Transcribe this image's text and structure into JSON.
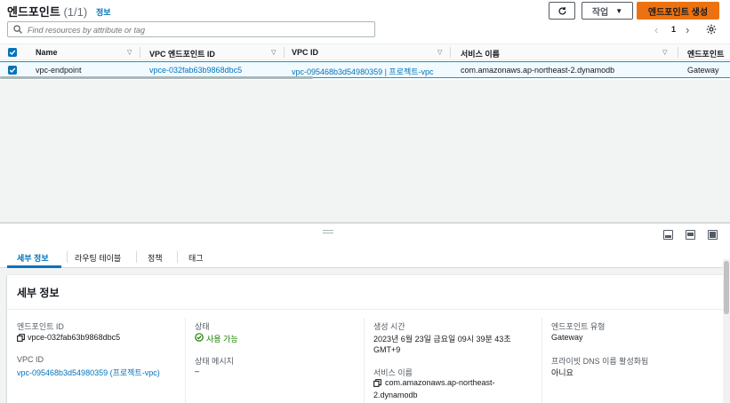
{
  "header": {
    "title": "엔드포인트",
    "count": "(1/1)",
    "info": "정보",
    "actions_label": "작업",
    "create_label": "엔드포인트 생성"
  },
  "search": {
    "placeholder": "Find resources by attribute or tag"
  },
  "pagination": {
    "current_page": "1"
  },
  "table": {
    "columns": [
      "Name",
      "VPC 엔드포인트 ID",
      "VPC ID",
      "서비스 이름",
      "엔드포인트"
    ],
    "rows": [
      {
        "name": "vpc-endpoint",
        "endpoint_id": "vpce-032fab63b9868dbc5",
        "vpc_id": "vpc-095468b3d54980359 | 프로젝트-vpc",
        "service_name": "com.amazonaws.ap-northeast-2.dynamodb",
        "endpoint_type": "Gateway"
      }
    ]
  },
  "tabs": [
    "세부 정보",
    "라우팅 테이블",
    "정책",
    "태그"
  ],
  "details": {
    "title": "세부 정보",
    "endpoint_id_label": "엔드포인트 ID",
    "endpoint_id": "vpce-032fab63b9868dbc5",
    "vpc_id_label": "VPC ID",
    "vpc_id": "vpc-095468b3d54980359 (프로젝트-vpc)",
    "status_label": "상태",
    "status": "사용 가능",
    "status_message_label": "상태 메시지",
    "status_message": "–",
    "created_label": "생성 시간",
    "created_line1": "2023년 6월 23일 금요일 09시 39분 43초",
    "created_line2": "GMT+9",
    "service_label": "서비스 이름",
    "service_line1": "com.amazonaws.ap-northeast-",
    "service_line2": "2.dynamodb",
    "type_label": "엔드포인트 유형",
    "type": "Gateway",
    "private_dns_label": "프라이빗 DNS 이름 활성화됨",
    "private_dns": "아니요"
  },
  "colors": {
    "link": "#0073bb",
    "primary_button": "#ec7211",
    "success": "#1d8102",
    "selected_row": "#f1faff"
  }
}
